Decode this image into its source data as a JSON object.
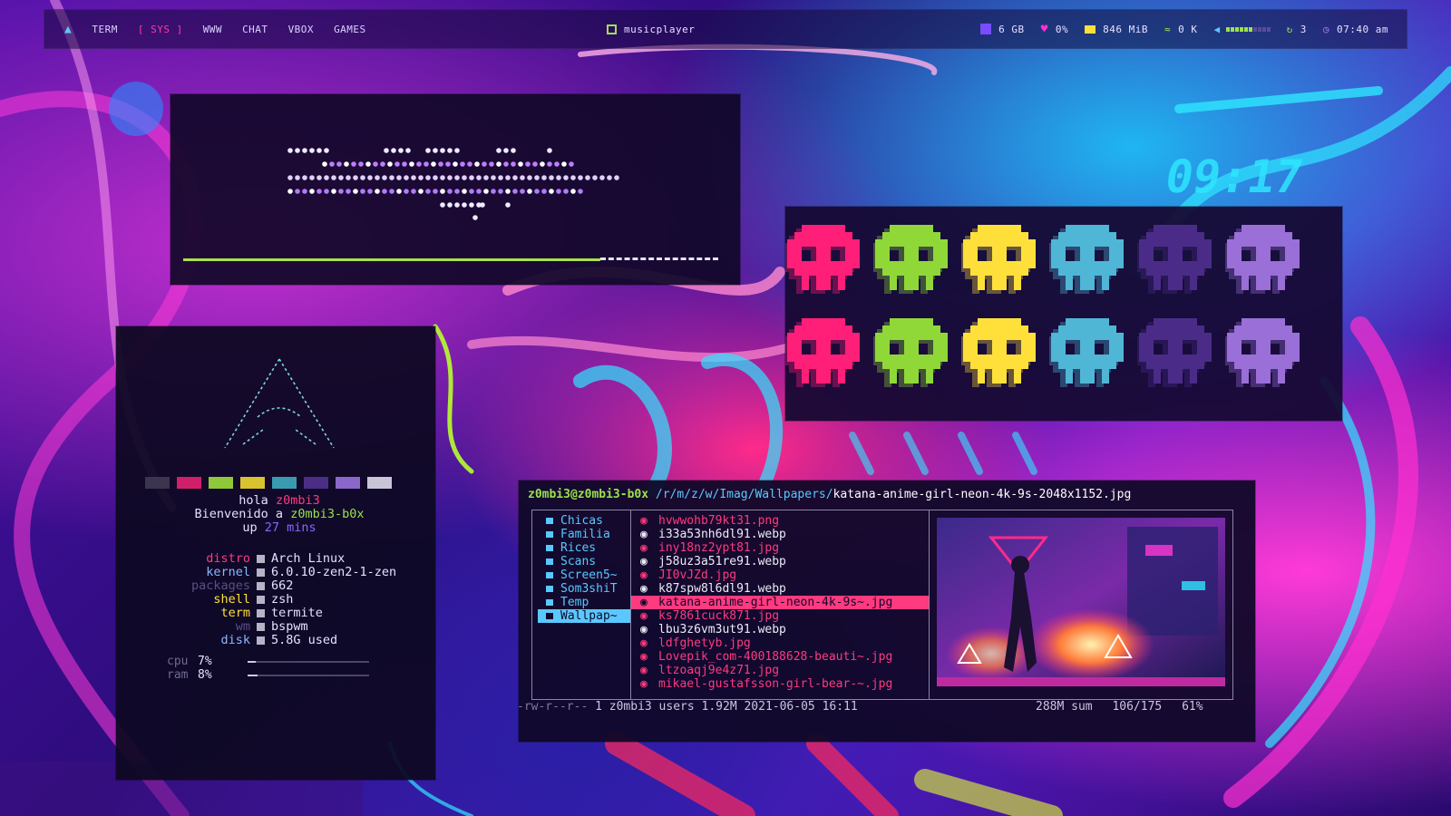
{
  "topbar": {
    "workspaces": [
      "TERM",
      "[ SYS ]",
      "WWW",
      "CHAT",
      "VBOX",
      "GAMES"
    ],
    "active_workspace": "[ SYS ]",
    "center_app": "musicplayer",
    "disk": "6 GB",
    "cpu": "0%",
    "memory": "846 MiB",
    "network": "0 K",
    "updates": "3",
    "clock": "07:40 am",
    "volume_level": 0.6
  },
  "neofetch": {
    "greeting_prefix": "hola",
    "user": "z0mbi3",
    "welcome_prefix": "Bienvenido a",
    "host": "z0mbi3-b0x",
    "uptime_prefix": "up",
    "uptime_value": "27",
    "uptime_unit": "mins",
    "info": [
      {
        "key": "distro",
        "value": "Arch Linux"
      },
      {
        "key": "kernel",
        "value": "6.0.10-zen2-1-zen"
      },
      {
        "key": "packages",
        "value": "662"
      },
      {
        "key": "shell",
        "value": "zsh"
      },
      {
        "key": "term",
        "value": "termite"
      },
      {
        "key": "wm",
        "value": "bspwm"
      },
      {
        "key": "disk",
        "value": "5.8G used"
      }
    ],
    "cpu_label": "cpu",
    "cpu_value": "7%",
    "cpu_fraction": 0.07,
    "ram_label": "ram",
    "ram_value": "8%",
    "ram_fraction": 0.08,
    "palette": [
      "#3b3550",
      "#d21f6a",
      "#8fc93a",
      "#d8c22e",
      "#3a9ab0",
      "#4a2e86",
      "#8a67c8",
      "#c9c5d8"
    ]
  },
  "music": {
    "progress_fraction": 0.78
  },
  "filemanager": {
    "prompt_user": "z0mbi3@z0mbi3-b0x",
    "prompt_dir": "/r/m/z/w/Imag/Wallpapers/",
    "prompt_file": "katana-anime-girl-neon-4k-9s-2048x1152.jpg",
    "dirs": [
      "Chicas",
      "Familia",
      "Rices",
      "Scans",
      "Screen5~",
      "Som3shiT",
      "Temp",
      "Wallpap~"
    ],
    "selected_dir": "Wallpap~",
    "files": [
      {
        "name": "hvwwohb79kt31.png",
        "tone": "pink"
      },
      {
        "name": "i33a53nh6dl91.webp",
        "tone": "white"
      },
      {
        "name": "iny18nz2ypt81.jpg",
        "tone": "pink"
      },
      {
        "name": "j58uz3a51re91.webp",
        "tone": "white"
      },
      {
        "name": "JI0vJZd.jpg",
        "tone": "pink"
      },
      {
        "name": "k87spw8l6dl91.webp",
        "tone": "white"
      },
      {
        "name": "katana-anime-girl-neon-4k-9s~.jpg",
        "tone": "sel"
      },
      {
        "name": "ks7861cuck871.jpg",
        "tone": "pink"
      },
      {
        "name": "lbu3z6vm3ut91.webp",
        "tone": "white"
      },
      {
        "name": "ldfghetyb.jpg",
        "tone": "pink"
      },
      {
        "name": "Lovepik_com-400188628-beauti~.jpg",
        "tone": "pink"
      },
      {
        "name": "ltzoaqj9e4z71.jpg",
        "tone": "pink"
      },
      {
        "name": "mikael-gustafsson-girl-bear-~.jpg",
        "tone": "pink"
      }
    ],
    "status_perms": "-rw-r--r--",
    "status_info": "1 z0mbi3 users 1.92M 2021-06-05 16:11",
    "status_sum": "288M sum",
    "status_pos": "106/175",
    "status_pct": "61%"
  },
  "skull_colors": [
    "#ff1f78",
    "#8fd838",
    "#ffe03a",
    "#4fb6d6",
    "#4a2c88",
    "#9a6fd8"
  ],
  "wallpaper_clock": "09:17",
  "colors": {
    "accent_green": "#9be24a",
    "accent_pink": "#ff3a7f",
    "accent_blue": "#5ac8ff"
  }
}
